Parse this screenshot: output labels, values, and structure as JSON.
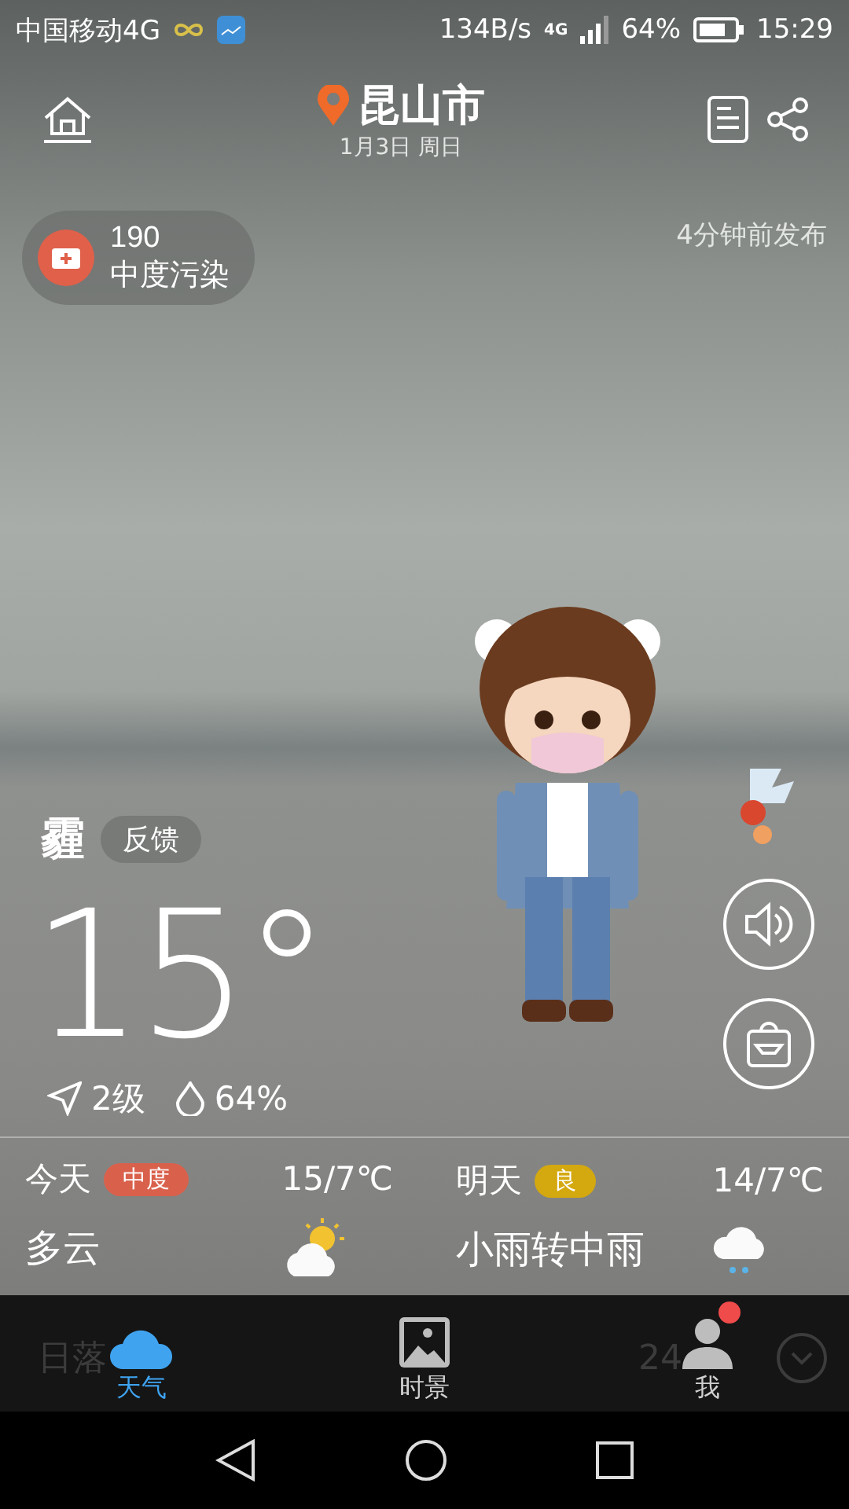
{
  "status_bar": {
    "carrier": "中国移动4G",
    "speed": "134B/s",
    "network": "4G",
    "battery": "64%",
    "time": "15:29"
  },
  "header": {
    "city": "昆山市",
    "date": "1月3日 周日"
  },
  "air_quality": {
    "value": "190",
    "label": "中度污染"
  },
  "published": "4分钟前发布",
  "condition": {
    "name": "霾",
    "feedback": "反馈"
  },
  "temperature": "15°",
  "wind": "2级",
  "humidity": "64%",
  "forecast": [
    {
      "day": "今天",
      "quality": "中度",
      "color": "#d9614c",
      "temps": "15/7℃",
      "weather": "多云",
      "kind": "partly-cloudy"
    },
    {
      "day": "明天",
      "quality": "良",
      "color": "#d4a80f",
      "temps": "14/7℃",
      "weather": "小雨转中雨",
      "kind": "rain"
    }
  ],
  "hidden_row": {
    "sunset": "日落",
    "hourly": "24"
  },
  "tabs": [
    {
      "label": "天气",
      "selected": true,
      "kind": "cloud",
      "badge": false
    },
    {
      "label": "时景",
      "selected": false,
      "kind": "picture",
      "badge": false
    },
    {
      "label": "我",
      "selected": false,
      "kind": "person",
      "badge": true
    }
  ]
}
